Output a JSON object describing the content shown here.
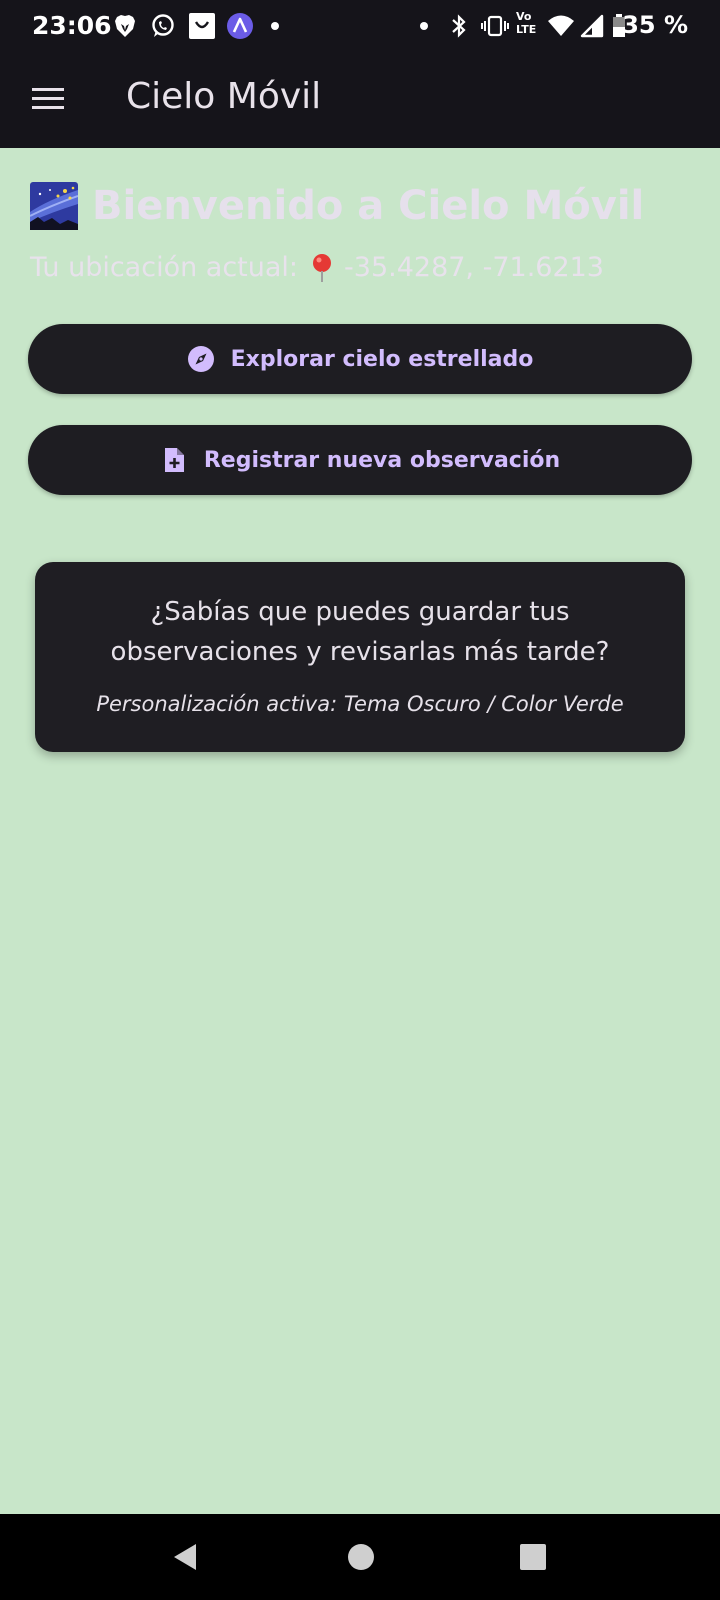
{
  "status_bar": {
    "time": "23:06",
    "battery_percent": "35 %",
    "left_icons": [
      "brave-icon",
      "whatsapp-icon",
      "shopping-bag-icon",
      "arc-icon",
      "dot-icon"
    ],
    "right_icons": [
      "dot-icon",
      "bluetooth-icon",
      "vibrate-icon",
      "volte-icon",
      "wifi-icon",
      "signal-icon",
      "battery-icon"
    ],
    "volte_label_top": "Vo",
    "volte_label_bottom": "LTE"
  },
  "app_bar": {
    "title": "Cielo Móvil",
    "menu_icon": "menu-icon"
  },
  "content": {
    "welcome_title": "Bienvenido a Cielo Móvil",
    "location_label": "Tu ubicación actual:",
    "location_coords": "-35.4287, -71.6213",
    "buttons": {
      "explore": {
        "label": "Explorar cielo estrellado",
        "icon": "compass-icon"
      },
      "register": {
        "label": "Registrar nueva observación",
        "icon": "note-add-icon"
      }
    },
    "tip_card": {
      "text": "¿Sabías que puedes guardar tus observaciones y revisarlas más tarde?",
      "footer": "Personalización activa: Tema Oscuro / Color Verde"
    }
  },
  "nav_bar": {
    "icons": [
      "back-icon",
      "home-icon",
      "recents-icon"
    ]
  },
  "colors": {
    "background": "#C8E6C9",
    "bars": "#15141A",
    "button_bg": "#1E1D22",
    "accent": "#D2BCFD",
    "card_bg": "#1F1E23"
  }
}
